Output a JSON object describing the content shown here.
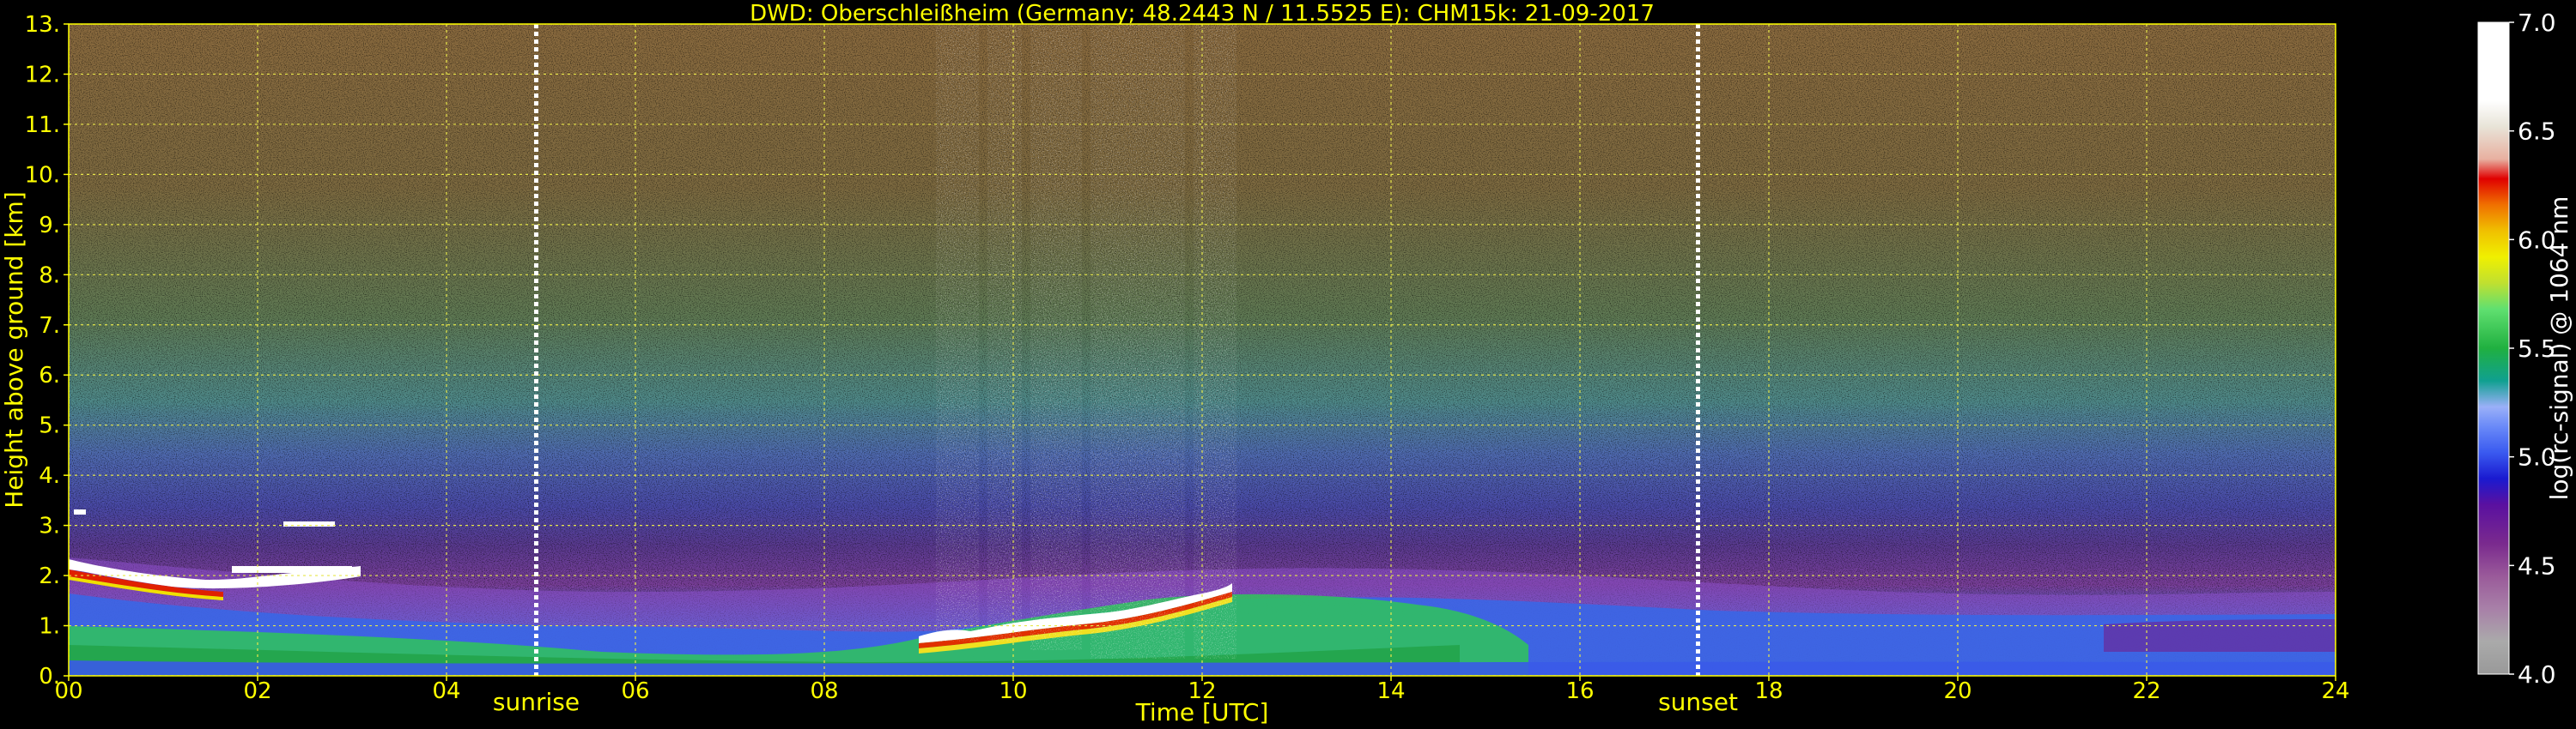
{
  "chart_data": {
    "type": "heatmap",
    "title": "DWD: Oberschleißheim (Germany; 48.2443 N / 11.5525 E):    CHM15k: 21-09-2017",
    "xlabel": "Time [UTC]",
    "ylabel": "Height above ground [km]",
    "x_range": [
      0,
      24
    ],
    "y_range": [
      0,
      13
    ],
    "x_ticks": [
      "00",
      "02",
      "04",
      "06",
      "08",
      "10",
      "12",
      "14",
      "16",
      "18",
      "20",
      "22",
      "24"
    ],
    "y_ticks": [
      "0.",
      "1.",
      "2.",
      "3.",
      "4.",
      "5.",
      "6.",
      "7.",
      "8.",
      "9.",
      "10.",
      "11.",
      "12.",
      "13."
    ],
    "grid": true,
    "annotations": [
      {
        "label": "sunrise",
        "x": 4.95
      },
      {
        "label": "sunset",
        "x": 17.25
      }
    ],
    "colorbar": {
      "label": "log(rc-signal) @ 1064 nm",
      "range": [
        4.0,
        7.0
      ],
      "ticks": [
        "4.0",
        "4.5",
        "5.0",
        "5.5",
        "6.0",
        "6.5",
        "7.0"
      ]
    },
    "colors": {
      "title": "#ffff00",
      "axis_labels": "#ffff00",
      "grid": "#e8e84a",
      "colorbar_text": "#ffffff",
      "background": "#000000"
    }
  }
}
